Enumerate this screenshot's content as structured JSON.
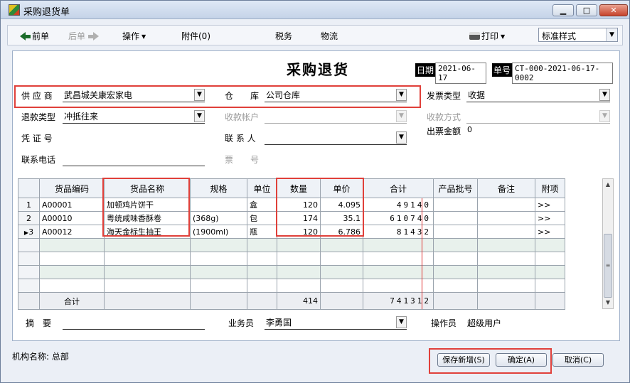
{
  "window": {
    "title": "采购退货单",
    "min": "▁",
    "max": "□",
    "close": "✕"
  },
  "toolbar": {
    "prev": "前单",
    "next": "后单",
    "operations": "操作",
    "attachments": "附件(0)",
    "tax": "税务",
    "logistics": "物流",
    "print": "打印",
    "style_value": "标准样式"
  },
  "doc": {
    "title": "采购退货",
    "date_label": "日期",
    "date_value": "2021-06-17",
    "number_label": "单号",
    "number_value": "CT-000-2021-06-17-0002"
  },
  "fields": {
    "supplier_label": "供 应 商",
    "supplier_value": "武昌城关康宏家电",
    "warehouse_label": "仓　　库",
    "warehouse_value": "公司仓库",
    "invoice_type_label": "发票类型",
    "invoice_type_value": "收据",
    "refund_type_label": "退款类型",
    "refund_type_value": "冲抵往来",
    "account_label": "收款帐户",
    "account_value": "",
    "payment_method_label": "收款方式",
    "payment_method_value": "",
    "voucher_label": "凭 证 号",
    "contact_label": "联 系 人",
    "contact_value": "",
    "invoice_amount_label": "出票金额",
    "invoice_amount_value": "0",
    "phone_label": "联系电话",
    "phone_value": "",
    "ticket_label": "票　　号"
  },
  "table": {
    "headers": [
      "货品编码",
      "货品名称",
      "规格",
      "单位",
      "数量",
      "单价",
      "合计",
      "产品批号",
      "备注",
      "附项"
    ],
    "rows": [
      {
        "no": "1",
        "code": "A00001",
        "name": "加顿鸡片饼干",
        "spec": "",
        "unit": "盒",
        "qty": "120",
        "price": "4.095",
        "total": "49140",
        "batch": "",
        "note": "",
        "extra": ">>"
      },
      {
        "no": "2",
        "code": "A00010",
        "name": "粤统咸味香酥卷",
        "spec": "(368g)",
        "unit": "包",
        "qty": "174",
        "price": "35.1",
        "total": "610740",
        "batch": "",
        "note": "",
        "extra": ">>"
      },
      {
        "no": "3",
        "code": "A00012",
        "name": "海天金标生抽王",
        "spec": "(1900ml)",
        "unit": "瓶",
        "qty": "120",
        "price": "6.786",
        "total": "81432",
        "batch": "",
        "note": "",
        "extra": ">>"
      }
    ],
    "current_marker": "▶",
    "totals_label": "合计",
    "totals_qty": "414",
    "totals_amount": "741312"
  },
  "footer": {
    "summary_label": "摘　要",
    "summary_value": "",
    "salesman_label": "业务员",
    "salesman_value": "李勇国",
    "operator_label": "操作员",
    "operator_value": "超级用户"
  },
  "status": {
    "org_label": "机构名称:",
    "org_value": "总部"
  },
  "buttons": {
    "save_new": "保存新增(S)",
    "confirm": "确定(A)",
    "cancel": "取消(C)"
  },
  "colors": {
    "highlight_red": "#e0403a",
    "accent_green": "#1b6c2a"
  }
}
